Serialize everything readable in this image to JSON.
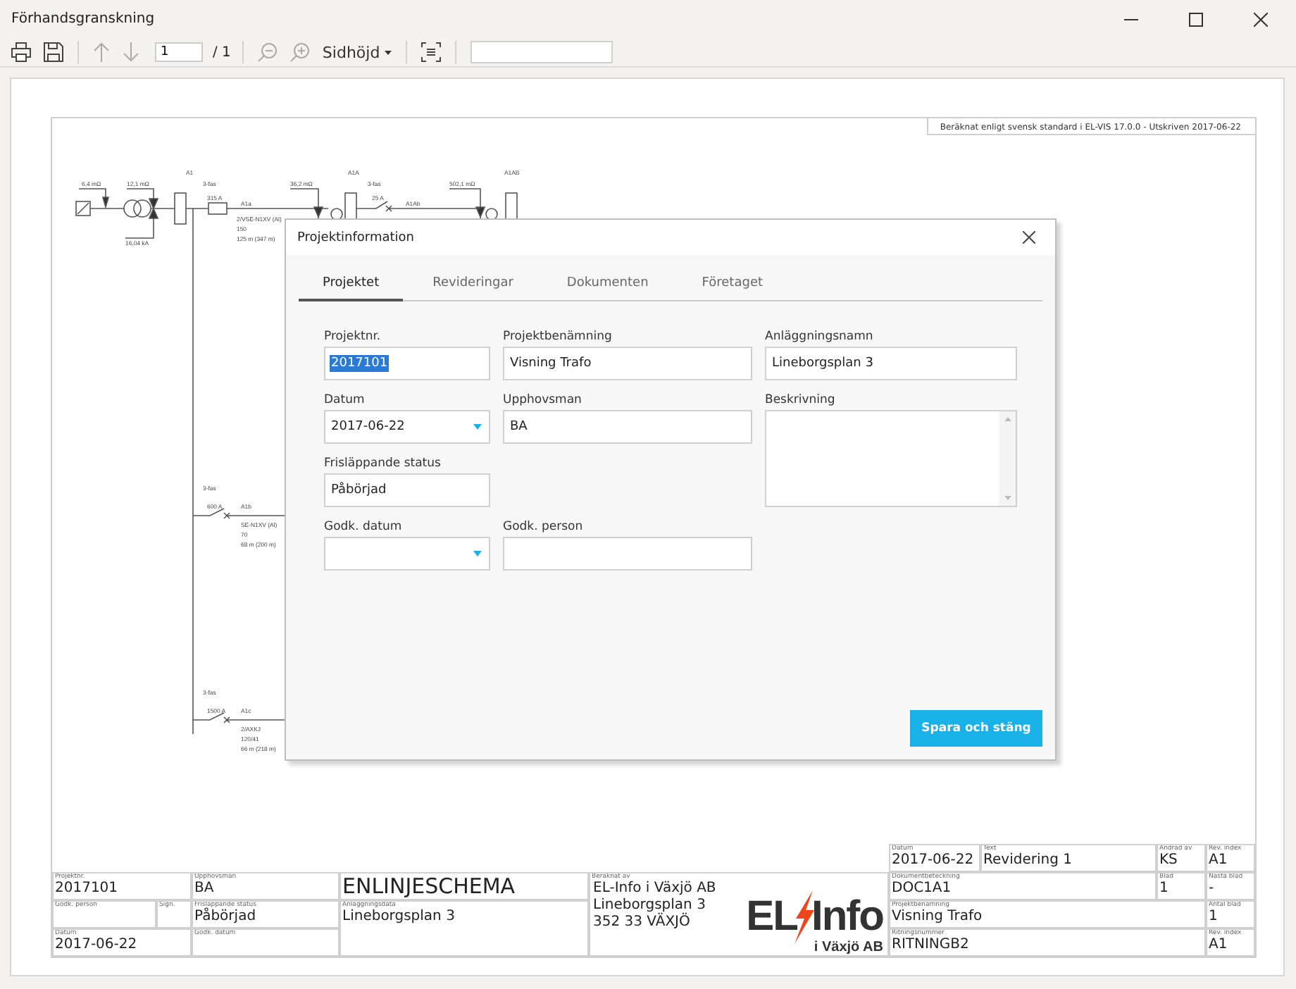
{
  "window": {
    "title": "Förhandsgranskning"
  },
  "toolbar": {
    "page_value": "1",
    "page_total": "/ 1",
    "zoom_mode": "Sidhöjd"
  },
  "page": {
    "note": "Beräknat enligt svensk standard i EL-VIS 17.0.0 - Utskriven 2017-06-22",
    "schematic_labels": [
      "6,4 mΩ",
      "12,1 mΩ",
      "16,04 kA",
      "A1",
      "3-fas",
      "315 A",
      "A1a",
      "2/VSE-N1XV (Al)",
      "150",
      "125 m (347 m)",
      "36,2 mΩ",
      "A1A",
      "3-fas",
      "25 A",
      "A1Ab",
      "502,1 mΩ",
      "A1AB",
      "3-fas",
      "600 A",
      "A1b",
      "SE-N1XV (Al)",
      "70",
      "68 m (200 m)",
      "3-fas",
      "1500 A",
      "A1c",
      "2/AXKJ",
      "120/41",
      "66 m (218 m)"
    ],
    "title_block": [
      {
        "label": "Datum",
        "value": "2017-06-22"
      },
      {
        "label": "Text",
        "value": "Revidering 1"
      },
      {
        "label": "Ändrad av",
        "value": "KS"
      },
      {
        "label": "Rev. index",
        "value": "A1"
      },
      {
        "label": "Projektnr.",
        "value": "2017101"
      },
      {
        "label": "Upphovsman",
        "value": "BA"
      },
      {
        "kind": "title",
        "value": "ENLINJESCHEMA"
      },
      {
        "kind": "company",
        "label": "Beräknat av",
        "lines": [
          "EL-Info i Växjö AB",
          "Lineborgsplan 3",
          " 352 33 VÄXJÖ"
        ]
      },
      {
        "label": "Dokumentbeteckning",
        "value": "DOC1A1"
      },
      {
        "label": "Blad",
        "value": "1"
      },
      {
        "label": "Nästa blad",
        "value": "-"
      },
      {
        "label": "Godk. person"
      },
      {
        "label": "Sign."
      },
      {
        "label": "Frisläppande status",
        "value": "Påbörjad"
      },
      {
        "label": "Anläggningsdata",
        "value": "Lineborgsplan 3"
      },
      {
        "label": "Projektbenämning",
        "value": "Visning Trafo"
      },
      {
        "label": "Antal blad",
        "value": "1"
      },
      {
        "label": "Datum",
        "value": "2017-06-22"
      },
      {
        "label": "Godk. datum"
      },
      {
        "label": "Ritningsnummer",
        "value": "RITNINGB2"
      },
      {
        "label": "Rev. index",
        "value": "A1"
      }
    ],
    "logo": {
      "left": "EL",
      "right": "Info",
      "sub": "i Växjö AB"
    }
  },
  "dialog": {
    "title": "Projektinformation",
    "tabs": [
      {
        "label": "Projektet",
        "selected": true
      },
      {
        "label": "Revideringar",
        "selected": false
      },
      {
        "label": "Dokumenten",
        "selected": false
      },
      {
        "label": "Företaget",
        "selected": false
      }
    ],
    "fields": [
      {
        "kind": "text",
        "label": "Projektnr.",
        "value": "2017101",
        "text_selected": true
      },
      {
        "kind": "text",
        "label": "Projektbenämning",
        "value": "Visning Trafo"
      },
      {
        "kind": "text",
        "label": "Anläggningsnamn",
        "value": "Lineborgsplan 3"
      },
      {
        "kind": "date",
        "label": "Datum",
        "value": "2017-06-22"
      },
      {
        "kind": "text",
        "label": "Upphovsman",
        "value": "BA"
      },
      {
        "kind": "textarea",
        "label": "Beskrivning"
      },
      {
        "kind": "text",
        "label": "Frisläppande status",
        "value": "Påbörjad"
      },
      {
        "kind": "date",
        "label": "Godk. datum"
      },
      {
        "kind": "text",
        "label": "Godk. person"
      }
    ],
    "button": "Spara och stäng"
  }
}
